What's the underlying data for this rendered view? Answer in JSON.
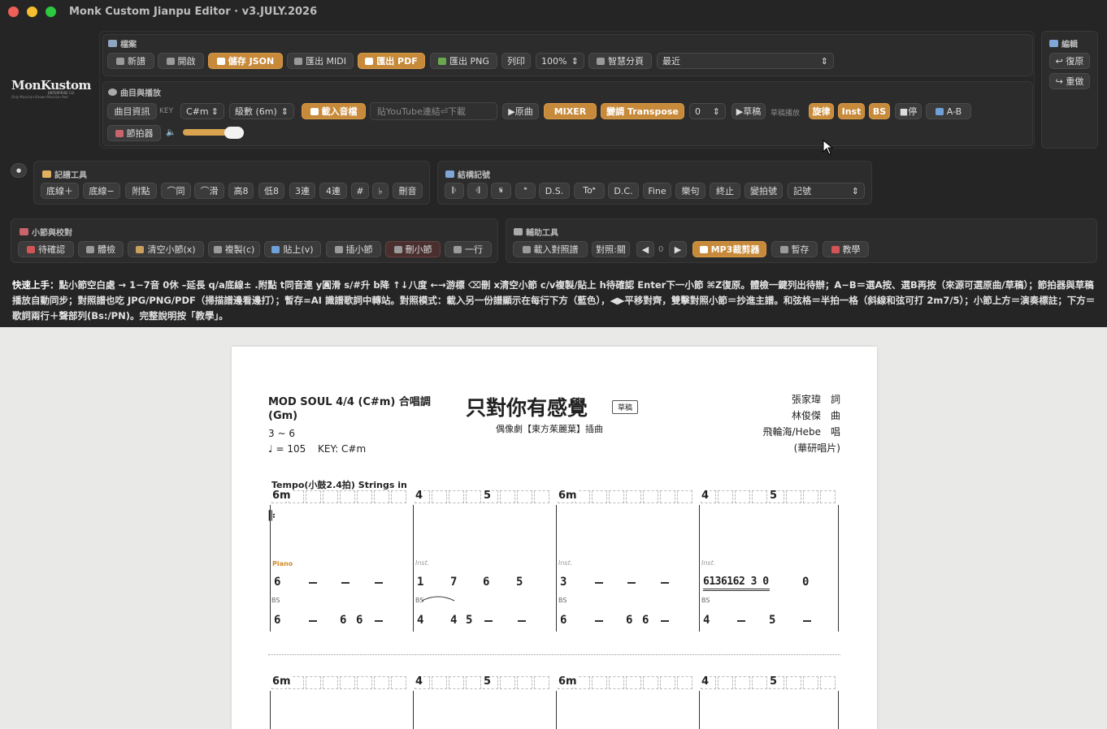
{
  "app": {
    "title": "Monk Custom Jianpu Editor · v3.JULY.2026"
  },
  "logo": {
    "name": "MonKustom",
    "sub": "ENTERPRISE CO.",
    "tag": "Only Musician Knows Musician feel"
  },
  "file_panel": {
    "title": "檔案",
    "new": "新譜",
    "open": "開啟",
    "save_json": "儲存 JSON",
    "export_midi": "匯出 MIDI",
    "export_pdf": "匯出 PDF",
    "export_png": "匯出 PNG",
    "print": "列印",
    "zoom": "100%",
    "smart_page": "智慧分頁",
    "recent": "最近"
  },
  "edit_panel": {
    "title": "編輯",
    "undo": "↩ 復原",
    "redo": "↪ 重做"
  },
  "song_panel": {
    "title": "曲目與播放",
    "info": "曲目資訊",
    "key_label": "KEY",
    "key": "C#m",
    "grade": "級數 (6m)",
    "load_audio": "載入音檔",
    "youtube_placeholder": "貼YouTube連結⏎下載",
    "play_original": "▶原曲",
    "mixer": "MIXER",
    "transpose": "變調 Transpose",
    "transpose_val": "0",
    "play_draft": "▶草稿",
    "draft_label": "草稿播放",
    "melody": "旋律",
    "inst": "Inst",
    "bs": "BS",
    "stop": "■停",
    "ab": "A-B",
    "metronome": "節拍器"
  },
  "notation_panel": {
    "title": "記譜工具",
    "items": [
      "底線＋",
      "底線−",
      "附點",
      "⌒同",
      "⌒滑",
      "高8",
      "低8",
      "3連",
      "4連",
      "#",
      "♭",
      "刪音"
    ]
  },
  "structure_panel": {
    "title": "結構記號",
    "items": [
      "𝄆",
      "𝄇",
      "𝄋",
      "𝄌",
      "D.S.",
      "To𝄌",
      "D.C.",
      "Fine",
      "樂句",
      "終止",
      "變拍號"
    ],
    "marks": "記號"
  },
  "measure_panel": {
    "title": "小節與校對",
    "items": [
      "待確認",
      "體檢",
      "清空小節(x)",
      "複製(c)",
      "貼上(v)",
      "插小節",
      "刪小節",
      "一行"
    ]
  },
  "aux_panel": {
    "title": "輔助工具",
    "load_ref": "載入對照譜",
    "compare": "對照:關",
    "offset": "0",
    "mp3_cut": "MP3裁剪器",
    "stash": "暫存",
    "tutorial": "教學"
  },
  "help": {
    "lead": "快速上手：",
    "text": "點小節空白處 → 1−7音 0休 –延長 q/a底線± .附點 t同音連 y圓滑 s/#升 b降 ↑↓八度 ←→游標 ⌫刪 x清空小節 c/v複製/貼上 h待確認 Enter下一小節 ⌘Z復原。體檢一鍵列出待辦；A−B＝選A按、選B再按（來源可選原曲/草稿）；節拍器與草稿播放自動同步；對照譜也吃 JPG/PNG/PDF（掃描譜邊看邊打）；暫存=AI 識譜歌詞中轉站。對照模式：載入另一份譜顯示在每行下方（藍色），◀▶平移對齊，雙擊對照小節＝抄進主譜。和弦格＝半拍一格（斜線和弦可打 2m7/5）；小節上方＝演奏標註；下方＝歌詞兩行＋聲部列(Bs:/PN)。完整說明按「教學」。"
  },
  "sheet": {
    "style": "MOD SOUL 4/4 (C#m) 合唱調",
    "key_grade": "(Gm)",
    "range": "3 ~ 6",
    "tempo": "♩ = 105",
    "key": "KEY: C#m",
    "title": "只對你有感覺",
    "draft": "草稿",
    "subtitle": "偶像劇【東方茱麗葉】插曲",
    "lyricist": "張家瑋　詞",
    "composer": "林俊傑　曲",
    "singer": "飛輪海/Hebe　唱",
    "label": "(華研唱片)",
    "marking": "Tempo(小鼓2.4拍) Strings in",
    "piano": "Piano",
    "inst": "Inst.",
    "bs": "BS"
  },
  "measures": [
    {
      "chords": [
        "6m"
      ],
      "c2": "",
      "part": "Piano",
      "top": "6",
      "bass": "6"
    },
    {
      "chords": [
        "4",
        "5"
      ],
      "part": "Inst.",
      "top": "1 7 6 5",
      "bass": "4 4 5"
    },
    {
      "chords": [
        "6m"
      ],
      "part": "Inst.",
      "top": "3",
      "bass": "6 6 6"
    },
    {
      "chords": [
        "4",
        "5"
      ],
      "part": "Inst.",
      "top": "6136162 3 0  0",
      "bass": "4 5"
    }
  ]
}
